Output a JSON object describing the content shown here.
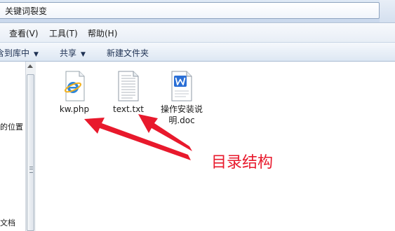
{
  "window": {
    "title": "关键词裂变"
  },
  "menubar": {
    "items": [
      "查看(V)",
      "工具(T)",
      "帮助(H)"
    ]
  },
  "toolbar": {
    "include_in_library": "含到库中",
    "share": "共享",
    "new_folder": "新建文件夹"
  },
  "nav": {
    "items": [
      "的位置",
      "文档"
    ]
  },
  "files": [
    {
      "name": "kw.php",
      "icon": "internet-explorer-file-icon"
    },
    {
      "name": "text.txt",
      "icon": "text-document-icon"
    },
    {
      "name_line1": "操作安装说",
      "name_line2": "明.doc",
      "icon": "word-document-icon"
    }
  ],
  "annotation": {
    "text": "目录结构",
    "color": "#e8192c"
  }
}
